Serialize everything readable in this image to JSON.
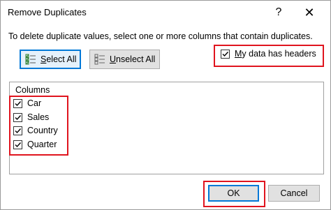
{
  "window": {
    "title": "Remove Duplicates",
    "help_glyph": "?",
    "close_glyph": "✕"
  },
  "instruction": "To delete duplicate values, select one or more columns that contain duplicates.",
  "buttons": {
    "select_all_prefix": "",
    "select_all_underlined": "S",
    "select_all_rest": "elect All",
    "unselect_all_underlined": "U",
    "unselect_all_rest": "nselect All",
    "ok": "OK",
    "cancel": "Cancel"
  },
  "headers_option": {
    "underlined": "M",
    "rest": "y data has headers",
    "checked": true
  },
  "columns": {
    "header": "Columns",
    "items": [
      {
        "label": "Car",
        "checked": true
      },
      {
        "label": "Sales",
        "checked": true
      },
      {
        "label": "Country",
        "checked": true
      },
      {
        "label": "Quarter",
        "checked": true
      }
    ]
  },
  "colors": {
    "highlight": "#e0141e",
    "focus": "#0078d7"
  }
}
